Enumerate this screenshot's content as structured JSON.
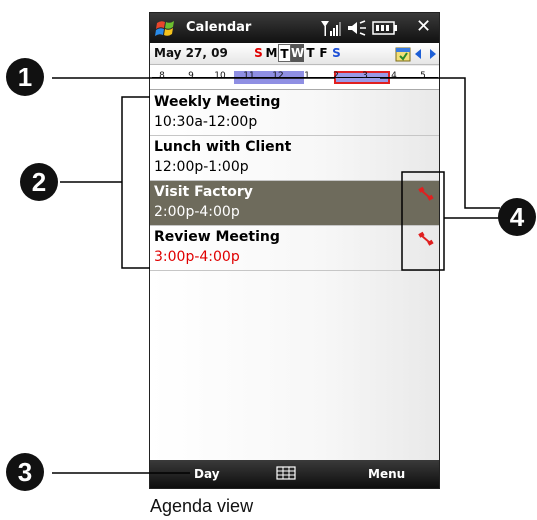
{
  "titlebar": {
    "title": "Calendar"
  },
  "datebar": {
    "date": "May 27, 09",
    "weekdays": [
      {
        "label": "S",
        "color": "#e00000"
      },
      {
        "label": "M",
        "color": "#000000"
      },
      {
        "label": "T",
        "color": "#000000",
        "state": "today"
      },
      {
        "label": "W",
        "color": "#ffffff",
        "state": "selected"
      },
      {
        "label": "T",
        "color": "#000000"
      },
      {
        "label": "F",
        "color": "#000000"
      },
      {
        "label": "S",
        "color": "#1d4fd6"
      }
    ]
  },
  "timeline": {
    "hours": [
      "8",
      "9",
      "10",
      "11",
      "12",
      "1",
      "2",
      "3",
      "4",
      "5"
    ]
  },
  "appointments": [
    {
      "title": "Weekly Meeting",
      "time": "10:30a-12:00p"
    },
    {
      "title": "Lunch with Client",
      "time": "12:00p-1:00p"
    },
    {
      "title": "Visit Factory",
      "time": "2:00p-4:00p",
      "selected": true,
      "conflict": true
    },
    {
      "title": "Review Meeting",
      "time": "3:00p-4:00p",
      "time_color": "#e00000",
      "conflict": true
    }
  ],
  "softkeys": {
    "left": "Day",
    "middle_icon": "grid-view-icon",
    "right": "Menu"
  },
  "callouts": {
    "c1": "1",
    "c2": "2",
    "c3": "3",
    "c4": "4"
  },
  "caption": "Agenda view",
  "colors": {
    "selected_row": "#6e6b5c",
    "timeline_block": "#8f8fe3",
    "highlight_box": "#e02020"
  }
}
